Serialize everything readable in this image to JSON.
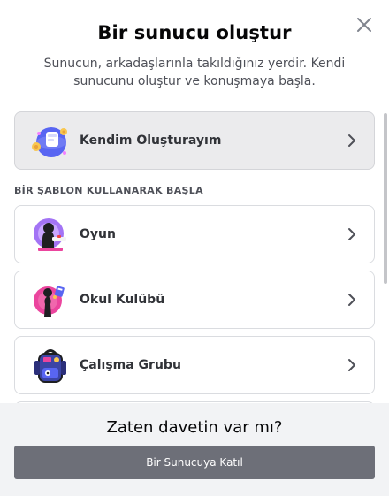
{
  "modal": {
    "title": "Bir sunucu oluştur",
    "subtitle": "Sunucun, arkadaşlarınla takıldığınız yerdir. Kendi sunucunu oluştur ve konuşmaya başla."
  },
  "options": {
    "create_own": {
      "label": "Kendim Oluşturayım",
      "icon": "globe-sticker-icon"
    },
    "template_header": "BİR ŞABLON KULLANARAK BAŞLA",
    "templates": [
      {
        "label": "Oyun",
        "icon": "gaming-sticker-icon"
      },
      {
        "label": "Okul Kulübü",
        "icon": "school-club-sticker-icon"
      },
      {
        "label": "Çalışma Grubu",
        "icon": "backpack-sticker-icon"
      }
    ]
  },
  "footer": {
    "title": "Zaten davetin var mı?",
    "join_button": "Bir Sunucuya Katıl"
  },
  "colors": {
    "primary_option_bg": "#ebebed",
    "footer_bg": "#f2f3f5",
    "join_button_bg": "#6d6f78"
  }
}
